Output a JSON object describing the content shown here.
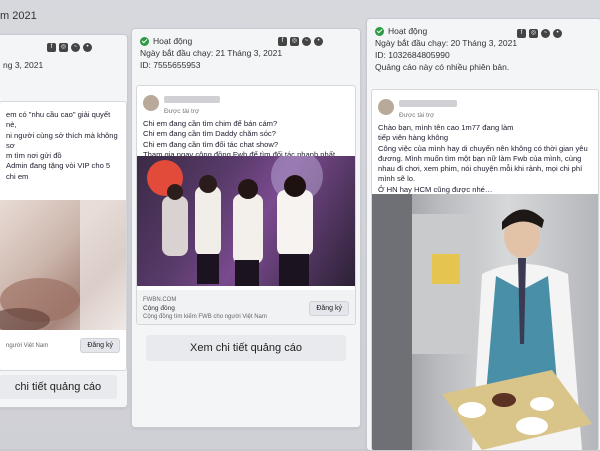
{
  "page": {
    "top_label": "m 2021"
  },
  "card_left": {
    "meta": "ng 3, 2021",
    "text_lines": [
      "em có \"nhu cầu cao\" giải quyết nè,",
      "ni người cùng sở thích mà không sơ",
      "m tìm nơi gửi đồ",
      "Admin đang tặng vòi VIP cho 5 chi em"
    ],
    "footer_small": "người Việt Nam",
    "register_label": "Đăng ký",
    "details_label": "chi tiết quảng cáo"
  },
  "card_middle": {
    "status": "Hoạt động",
    "start_date": "Ngày bắt đầu chạy: 21 Tháng 3, 2021",
    "id_label": "ID: 7555655953",
    "sponsored": "Được tài trợ",
    "text_lines": [
      "Chi em đang cần tìm chim để bán cám?",
      "Chi em đang cần tìm Daddy chăm sóc?",
      "Chi em đang cần tìm đối tác chat show?",
      "Tham gia ngay cộng đồng Fwb để tìm đối tác nhanh nhất nhé."
    ],
    "footer_domain": "FWBN.COM",
    "footer_name": "Cộng đồng",
    "footer_desc": "Cộng đồng tìm kiếm FWB cho người Việt Nam",
    "register_label": "Đăng ký",
    "details_label": "Xem chi tiết quảng cáo"
  },
  "card_right": {
    "status": "Hoạt động",
    "start_date": "Ngày bắt đầu chạy: 20 Tháng 3, 2021",
    "id_label": "ID: 1032684805990",
    "versions_note": "Quảng cáo này có nhiều phiên bản.",
    "sponsored": "Được tài trợ",
    "text_lines": [
      "Chào bạn, mình tên                cao 1m77  đang làm",
      "tiếp viên hàng không",
      "Công việc của mình hay di chuyển nên không có thời gian yêu",
      "đương. Mình muốn tìm một bạn nữ làm Fwb của mình, cùng",
      "nhau đi chơi, xem phim, nói chuyện mỗi khi rảnh, mọi chi phí",
      "mình sẽ lo.",
      "Ở HN hay HCM cũng được nhé…"
    ]
  },
  "colors": {
    "active": "#2e9b44",
    "background": "#cfd0d6"
  },
  "icons": [
    "facebook-icon",
    "instagram-icon",
    "messenger-icon",
    "audience-network-icon"
  ]
}
